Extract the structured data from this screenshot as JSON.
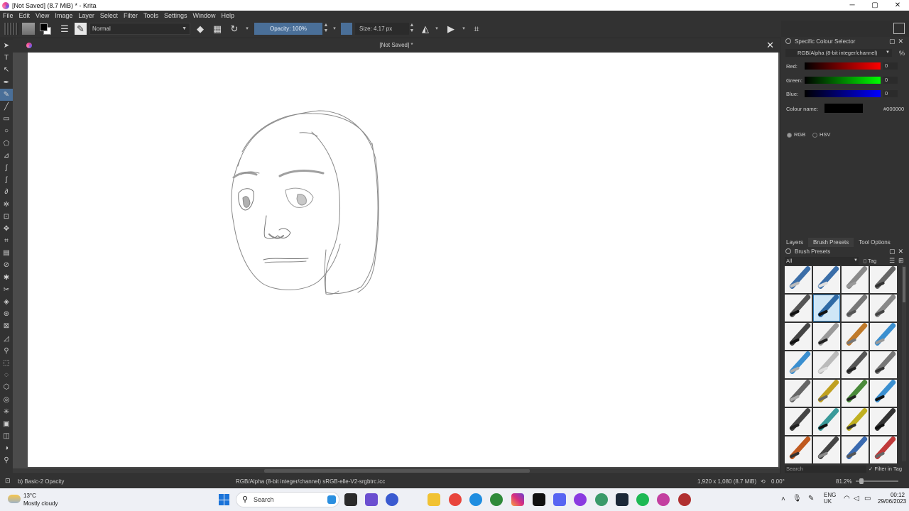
{
  "window": {
    "title": "[Not Saved]  (8.7 MiB)  * - Krita",
    "controls": [
      "─",
      "▢",
      "✕"
    ]
  },
  "menu": [
    "File",
    "Edit",
    "View",
    "Image",
    "Layer",
    "Select",
    "Filter",
    "Tools",
    "Settings",
    "Window",
    "Help"
  ],
  "toolbar": {
    "blend_mode": "Normal",
    "opacity_label": "Opacity: 100%",
    "size_label": "Size: 4.17 px"
  },
  "document": {
    "tab_label": "[Not Saved]  *",
    "close": "✕"
  },
  "color_selector": {
    "title": "Specific Colour Selector",
    "mode": "RGB/Alpha (8-bit integer/channel)",
    "channels": [
      {
        "label": "Red:",
        "value": "0"
      },
      {
        "label": "Green:",
        "value": "0"
      },
      {
        "label": "Blue:",
        "value": "0"
      }
    ],
    "colour_name_label": "Colour name:",
    "hex": "#000000",
    "radio_rgb": "RGB",
    "radio_hsv": "HSV"
  },
  "dock_tabs": [
    "Layers",
    "Brush Presets",
    "Tool Options"
  ],
  "brush_presets": {
    "title": "Brush Presets",
    "filter": "All",
    "tag_label": "Tag",
    "search_placeholder": "Search",
    "filter_in_tag": "Filter in Tag"
  },
  "status": {
    "preset": "b) Basic-2 Opacity",
    "color_profile": "RGB/Alpha (8-bit integer/channel)  sRGB-elle-V2-srgbtrc.icc",
    "dimensions": "1,920 x 1,080 (8.7 MiB)",
    "rotation": "0.00°",
    "zoom": "81.2%"
  },
  "taskbar": {
    "temperature": "13°C",
    "condition": "Mostly cloudy",
    "search": "Search",
    "lang_line1": "ENG",
    "lang_line2": "UK",
    "time": "00:12",
    "date": "29/06/2023"
  },
  "colors": {
    "accent": "#4a6f98",
    "panel": "#323232",
    "canvas": "#ffffff"
  }
}
